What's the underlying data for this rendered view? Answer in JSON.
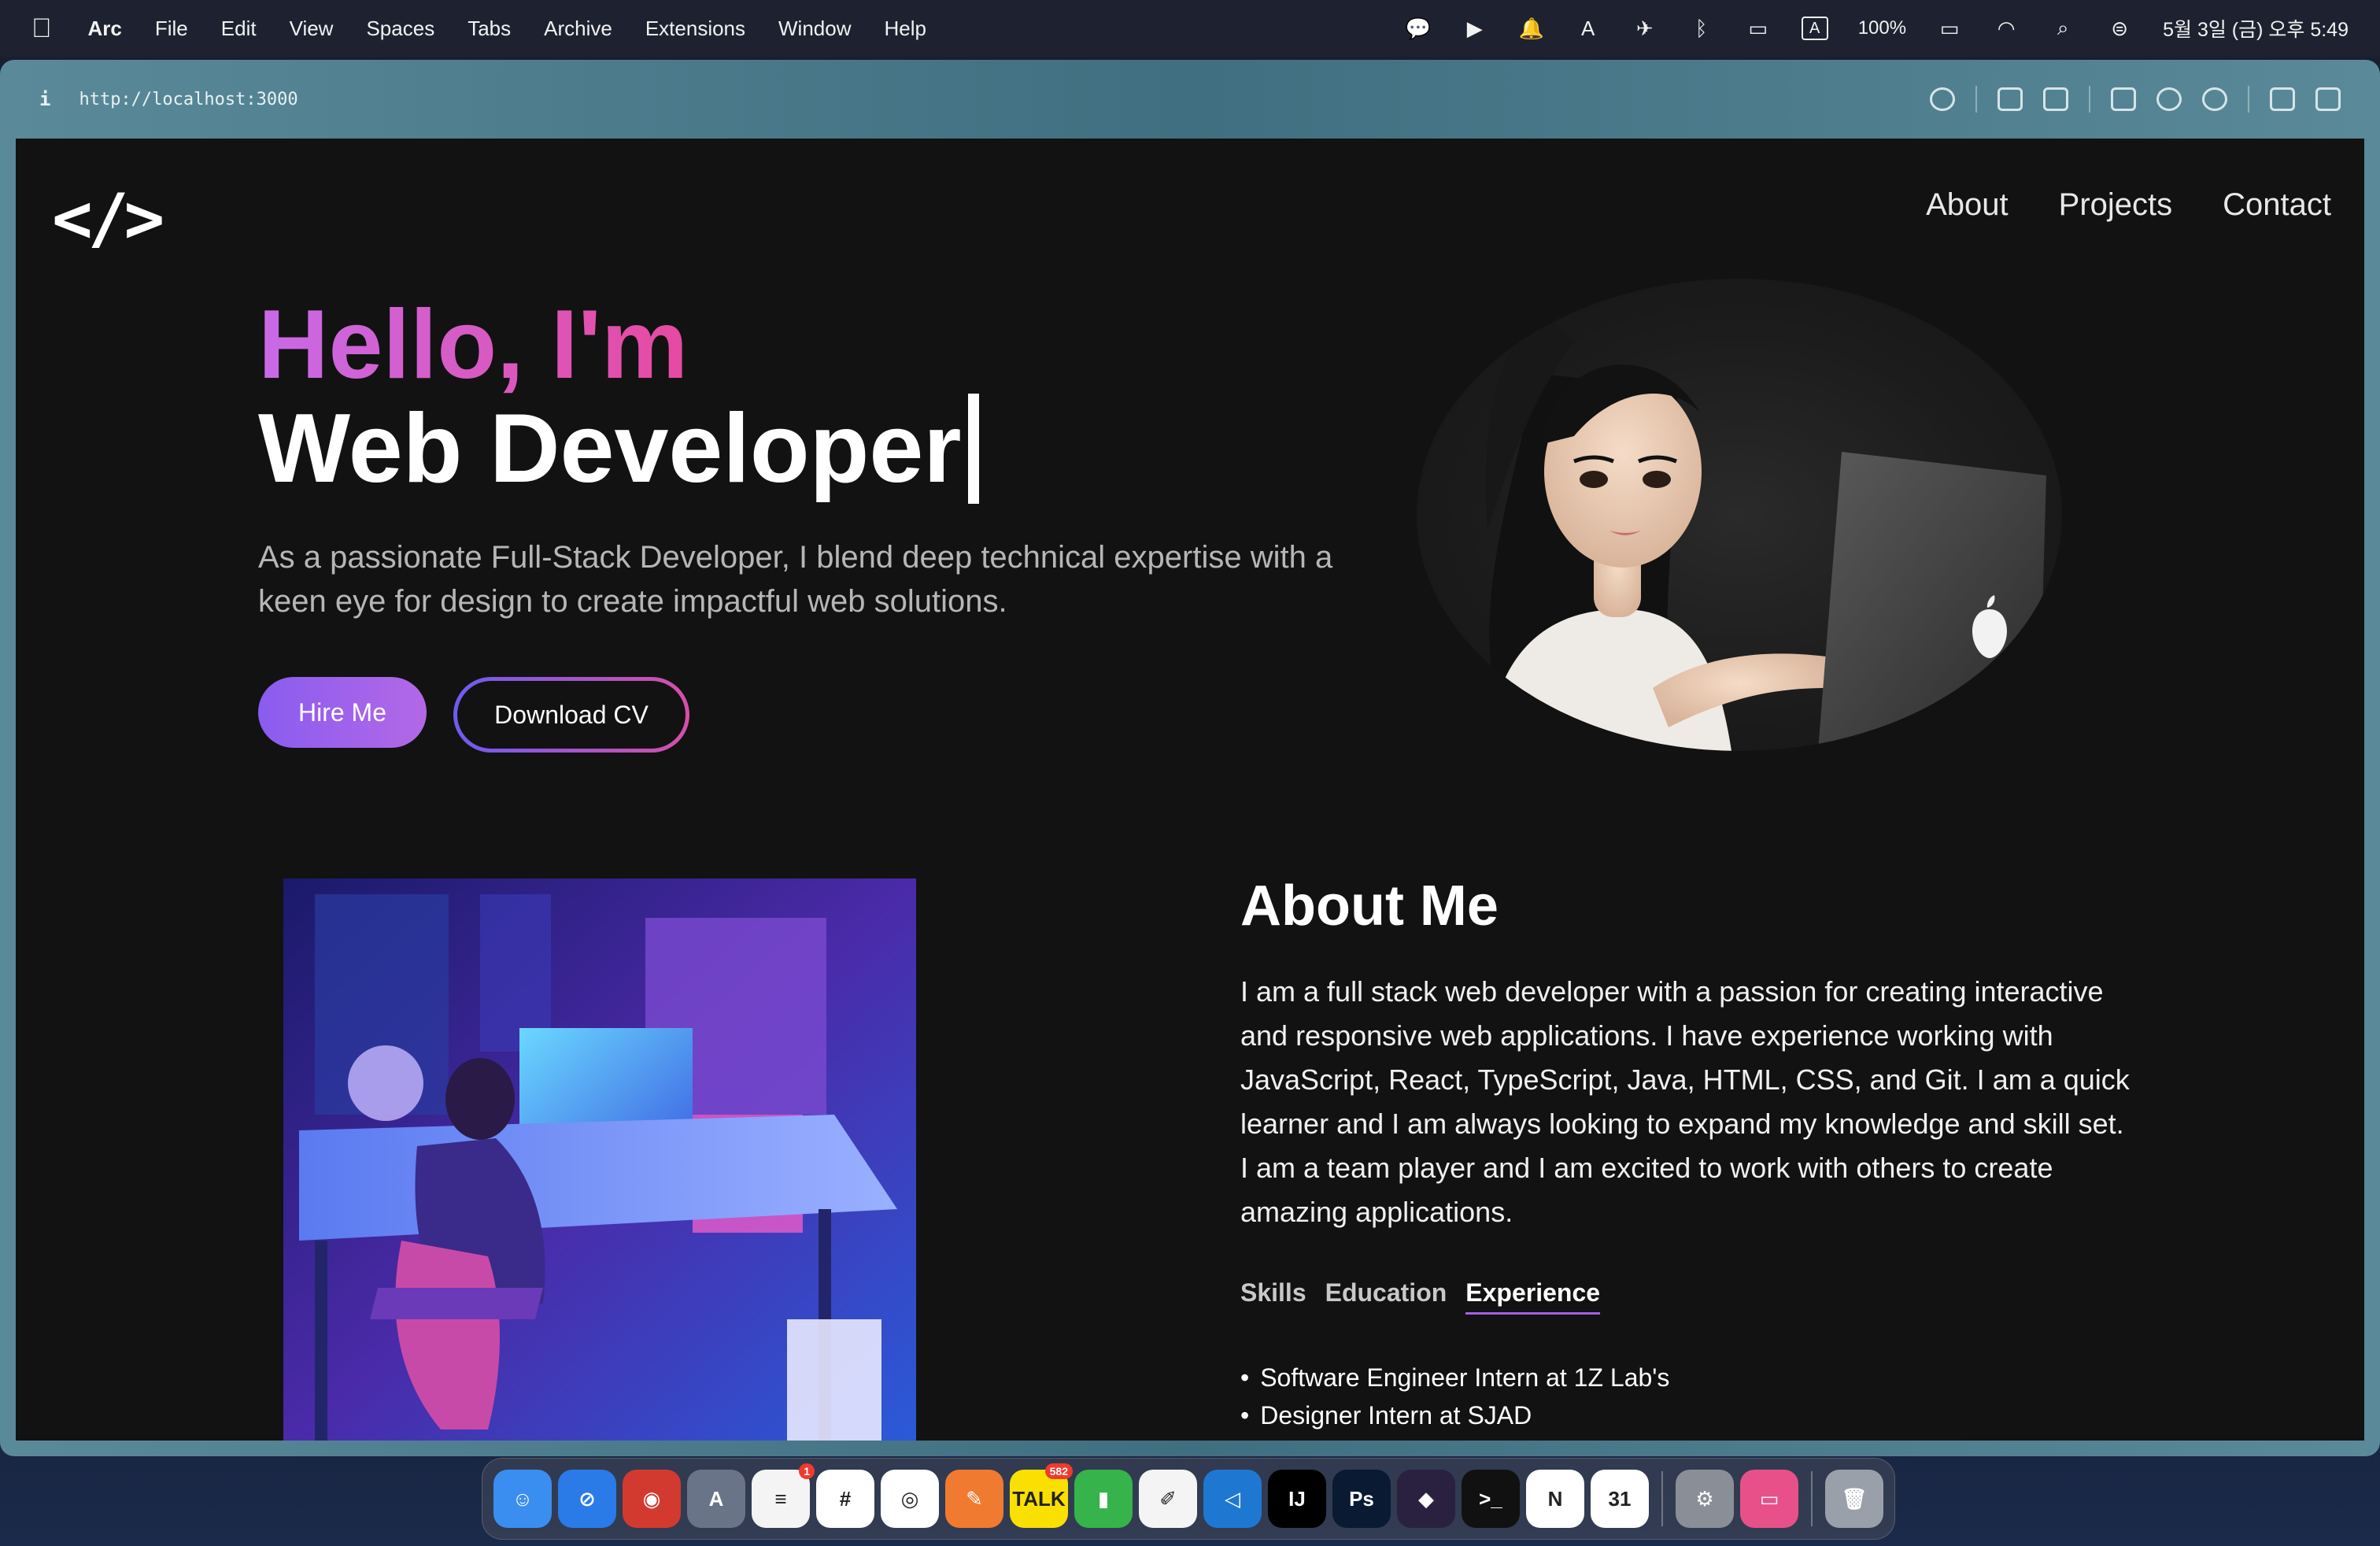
{
  "menubar": {
    "app": "Arc",
    "items": [
      "File",
      "Edit",
      "View",
      "Spaces",
      "Tabs",
      "Archive",
      "Extensions",
      "Window",
      "Help"
    ],
    "input_source": "A",
    "battery": "100%",
    "clock": "5월 3일 (금) 오후 5:49"
  },
  "browser": {
    "info_glyph": "i",
    "url": "http://localhost:3000"
  },
  "site": {
    "logo": "</>",
    "nav": [
      "About",
      "Projects",
      "Contact"
    ],
    "hero": {
      "hello": "Hello, I'm",
      "role": "Web Developer",
      "intro": "As a passionate Full-Stack Developer, I blend deep technical expertise with a keen eye for design to create impactful web solutions.",
      "hire_label": "Hire Me",
      "cv_label": "Download CV"
    },
    "about": {
      "title": "About Me",
      "bio": "I am a full stack web developer with a passion for creating interactive and responsive web applications. I have experience working with JavaScript, React, TypeScript, Java, HTML, CSS, and Git. I am a quick learner and I am always looking to expand my knowledge and skill set. I am a team player and I am excited to work with others to create amazing applications.",
      "tabs": [
        "Skills",
        "Education",
        "Experience"
      ],
      "active_tab": "Experience",
      "experience": [
        "Software Engineer Intern at 1Z Lab's",
        "Designer Intern at SJAD"
      ]
    }
  },
  "dock": {
    "apps": [
      {
        "name": "finder",
        "color": "#3a8ef0",
        "glyph": "☺"
      },
      {
        "name": "safari",
        "color": "#2a7ae8",
        "glyph": "⊘"
      },
      {
        "name": "photo-booth",
        "color": "#d23a30",
        "glyph": "◉"
      },
      {
        "name": "instruments",
        "color": "#6a7488",
        "glyph": "A"
      },
      {
        "name": "reminders",
        "color": "#f4f4f4",
        "glyph": "≡",
        "badge": "1"
      },
      {
        "name": "slack",
        "color": "#ffffff",
        "glyph": "#"
      },
      {
        "name": "chrome",
        "color": "#ffffff",
        "glyph": "◎"
      },
      {
        "name": "pencil",
        "color": "#f07a30",
        "glyph": "✎"
      },
      {
        "name": "kakaotalk",
        "color": "#f9e000",
        "glyph": "TALK",
        "badge": "582"
      },
      {
        "name": "numbers",
        "color": "#36b34a",
        "glyph": "▮"
      },
      {
        "name": "freeform",
        "color": "#f4f4f4",
        "glyph": "✐"
      },
      {
        "name": "vscode",
        "color": "#1e78d2",
        "glyph": "◁"
      },
      {
        "name": "intellij",
        "color": "#000000",
        "glyph": "IJ"
      },
      {
        "name": "photoshop",
        "color": "#0a1a33",
        "glyph": "Ps"
      },
      {
        "name": "obsidian",
        "color": "#2a2040",
        "glyph": "◆"
      },
      {
        "name": "terminal",
        "color": "#111111",
        "glyph": ">_"
      },
      {
        "name": "notion",
        "color": "#ffffff",
        "glyph": "N"
      },
      {
        "name": "calendar",
        "color": "#ffffff",
        "glyph": "31"
      },
      {
        "name": "system-settings",
        "color": "#8a8e96",
        "glyph": "⚙"
      },
      {
        "name": "hidden-bar",
        "color": "#e8508a",
        "glyph": "▭"
      },
      {
        "name": "trash",
        "color": "#9aa0aa",
        "glyph": "🗑"
      }
    ]
  }
}
